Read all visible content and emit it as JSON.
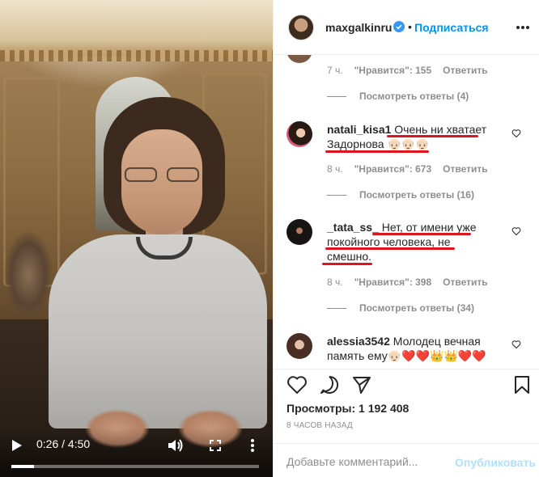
{
  "video": {
    "time": "0:26 / 4:50",
    "progress": 0.09
  },
  "header": {
    "username": "maxgalkinru",
    "separator": "•",
    "follow_label": "Подписаться"
  },
  "comments": {
    "partial_top": {
      "meta": {
        "time": "7 ч.",
        "likes": "\"Нравится\": 155",
        "reply": "Ответить"
      },
      "view_replies": "Посмотреть ответы (4)"
    },
    "items": [
      {
        "username": "natali_kisa1",
        "text_lines": [
          "Очень ни хватает",
          "Задорнова 👴🏻👴🏻👴🏻"
        ],
        "meta": {
          "time": "8 ч.",
          "likes": "\"Нравится\": 673",
          "reply": "Ответить"
        },
        "view_replies": "Посмотреть ответы (16)"
      },
      {
        "username": "_tata_ss_",
        "text_lines": [
          "Нет, от имени уже",
          "покойного человека, не",
          "смешно."
        ],
        "meta": {
          "time": "8 ч.",
          "likes": "\"Нравится\": 398",
          "reply": "Ответить"
        },
        "view_replies": "Посмотреть ответы (34)"
      },
      {
        "username": "alessia3542",
        "text_lines": [
          "Молодец вечная",
          "память ему👴🏻❤️❤️👑👑❤️❤️"
        ]
      }
    ]
  },
  "actions": {
    "views": "Просмотры: 1 192 408",
    "time_ago": "8 ЧАСОВ НАЗАД"
  },
  "add_comment": {
    "placeholder": "Добавьте комментарий...",
    "publish_label": "Опубликовать"
  },
  "colors": {
    "accent": "#0095f6",
    "publish_disabled": "#b2dffc",
    "underline": "#e0141e",
    "muted": "#8e8e8e"
  }
}
